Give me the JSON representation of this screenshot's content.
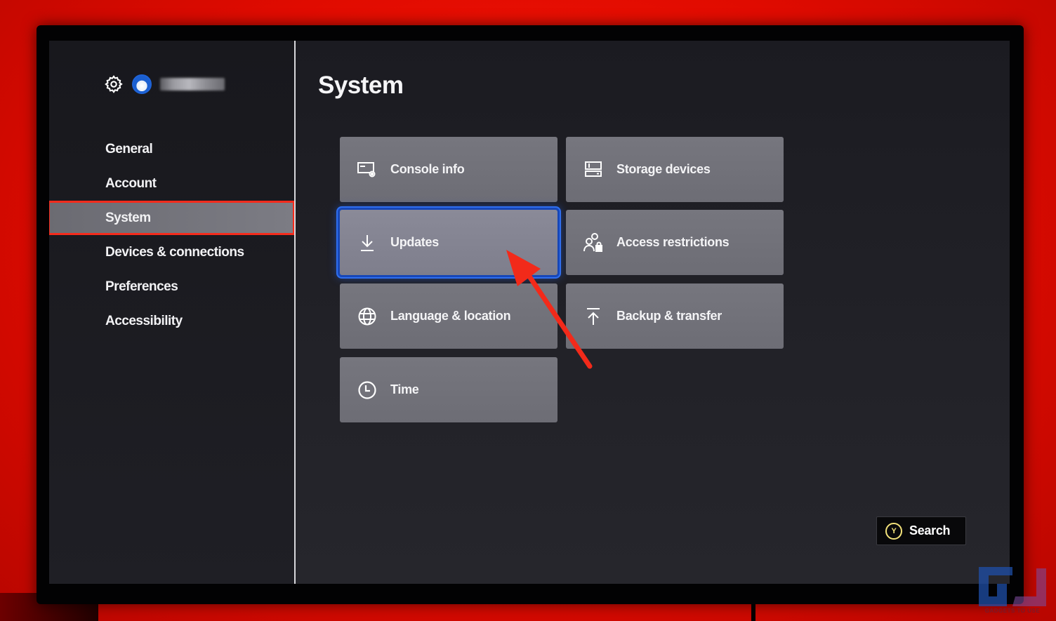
{
  "profile": {
    "settings_icon": "gear-icon",
    "avatar_icon": "profile-avatar",
    "gamertag_redacted": true
  },
  "sidebar": {
    "items": [
      {
        "label": "General",
        "selected": false
      },
      {
        "label": "Account",
        "selected": false
      },
      {
        "label": "System",
        "selected": true
      },
      {
        "label": "Devices & connections",
        "selected": false
      },
      {
        "label": "Preferences",
        "selected": false
      },
      {
        "label": "Accessibility",
        "selected": false
      }
    ]
  },
  "main": {
    "title": "System",
    "tiles": [
      {
        "label": "Console info",
        "icon": "console-info-icon",
        "focused": false
      },
      {
        "label": "Storage devices",
        "icon": "storage-icon",
        "focused": false
      },
      {
        "label": "Updates",
        "icon": "download-icon",
        "focused": true
      },
      {
        "label": "Access restrictions",
        "icon": "users-lock-icon",
        "focused": false
      },
      {
        "label": "Language & location",
        "icon": "globe-icon",
        "focused": false
      },
      {
        "label": "Backup & transfer",
        "icon": "upload-icon",
        "focused": false
      },
      {
        "label": "Time",
        "icon": "clock-icon",
        "focused": false
      }
    ]
  },
  "footer": {
    "search_button_glyph": "Y",
    "search_label": "Search"
  },
  "annotation": {
    "type": "arrow",
    "color": "#f22a1a",
    "points_to": "Updates"
  },
  "watermark": {
    "text": "GADGETS TO USE"
  },
  "colors": {
    "background_red": "#e00b00",
    "focus_blue": "#2f6ff0",
    "highlight_box": "#f42b1c",
    "y_button": "#f3e27a"
  }
}
